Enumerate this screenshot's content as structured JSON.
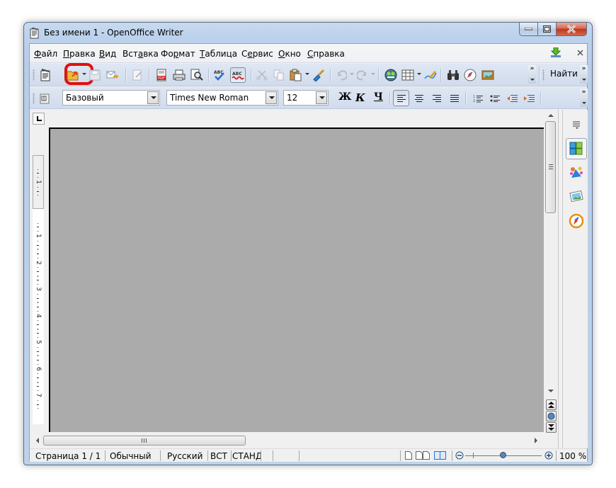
{
  "window": {
    "title": "Без имени 1 - OpenOffice Writer",
    "controls": {
      "minimize": "minimize",
      "maximize": "maximize",
      "close": "close"
    }
  },
  "menubar": {
    "items": [
      {
        "label": "Файл",
        "accel": "Ф",
        "rest": "айл"
      },
      {
        "label": "Правка",
        "accel": "П",
        "rest": "равка"
      },
      {
        "label": "Вид",
        "accel": "В",
        "rest": "ид"
      },
      {
        "label": "Вставка",
        "pre": "Вст",
        "accel": "а",
        "rest": "вка"
      },
      {
        "label": "Формат",
        "pre": "Фо",
        "accel": "р",
        "rest": "мат"
      },
      {
        "label": "Таблица",
        "accel": "Т",
        "rest": "аблица"
      },
      {
        "label": "Сервис",
        "pre": "С",
        "accel": "е",
        "rest": "рвис"
      },
      {
        "label": "Окно",
        "accel": "О",
        "rest": "кно"
      },
      {
        "label": "Справка",
        "accel": "С",
        "rest": "правка"
      }
    ],
    "update_icon": "download-update-icon",
    "close_doc_icon": "close-document-icon"
  },
  "standard_toolbar": {
    "buttons": [
      "new-document-icon",
      "open-folder-icon",
      "save-icon",
      "email-document-icon",
      "edit-file-icon",
      "export-pdf-icon",
      "print-icon",
      "page-preview-icon",
      "spellcheck-icon",
      "autospellcheck-icon",
      "cut-icon",
      "copy-icon",
      "paste-icon",
      "clone-formatting-icon",
      "undo-icon",
      "redo-icon",
      "gallery-icon",
      "table-icon",
      "draw-functions-icon",
      "find-replace-icon",
      "navigator-icon",
      "gallery-picture-icon"
    ],
    "highlighted": "open-folder-icon",
    "highlight_color": "#e01010",
    "find_label": "Найти"
  },
  "formatting_toolbar": {
    "paragraph_style": "Базовый",
    "font_name": "Times New Roman",
    "font_size": "12",
    "bold": "Ж",
    "italic": "К",
    "underline": "Ч",
    "align_active": "align-left"
  },
  "ruler": {
    "vertical_marks": [
      "1",
      "1",
      "2",
      "3",
      "4",
      "5",
      "6",
      "7"
    ]
  },
  "document": {
    "background_color": "#ababab"
  },
  "sidebar": {
    "items": [
      "properties-icon",
      "styles-icon",
      "gallery-icon",
      "navigator-icon"
    ]
  },
  "statusbar": {
    "page": "Страница 1 / 1",
    "style": "Обычный",
    "language": "Русский",
    "insert_mode": "ВСТ",
    "selection_mode": "СТАНД",
    "zoom": "100 %",
    "zoom_percent": 100
  }
}
